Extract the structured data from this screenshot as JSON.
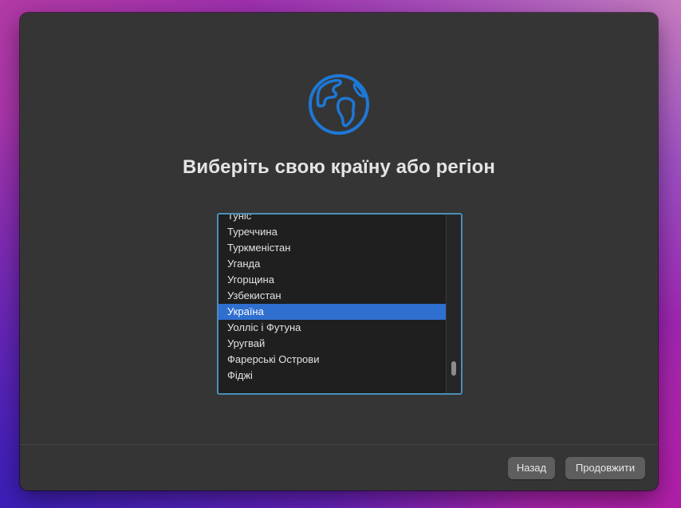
{
  "colors": {
    "window_bg": "#353535",
    "accent": "#2f6fcf",
    "globe": "#1e78d6",
    "list_border": "#4a8fb8"
  },
  "header": {
    "icon": "globe-icon",
    "title": "Виберіть свою країну або регіон"
  },
  "country_list": {
    "items": [
      {
        "label": "Туніс",
        "selected": false
      },
      {
        "label": "Туреччина",
        "selected": false
      },
      {
        "label": "Туркменістан",
        "selected": false
      },
      {
        "label": "Уганда",
        "selected": false
      },
      {
        "label": "Угорщина",
        "selected": false
      },
      {
        "label": "Узбекистан",
        "selected": false
      },
      {
        "label": "Україна",
        "selected": true
      },
      {
        "label": "Уолліс і Футуна",
        "selected": false
      },
      {
        "label": "Уругвай",
        "selected": false
      },
      {
        "label": "Фарерські Острови",
        "selected": false
      },
      {
        "label": "Фіджі",
        "selected": false
      }
    ],
    "selected_value": "Україна"
  },
  "footer": {
    "back_label": "Назад",
    "continue_label": "Продовжити"
  }
}
